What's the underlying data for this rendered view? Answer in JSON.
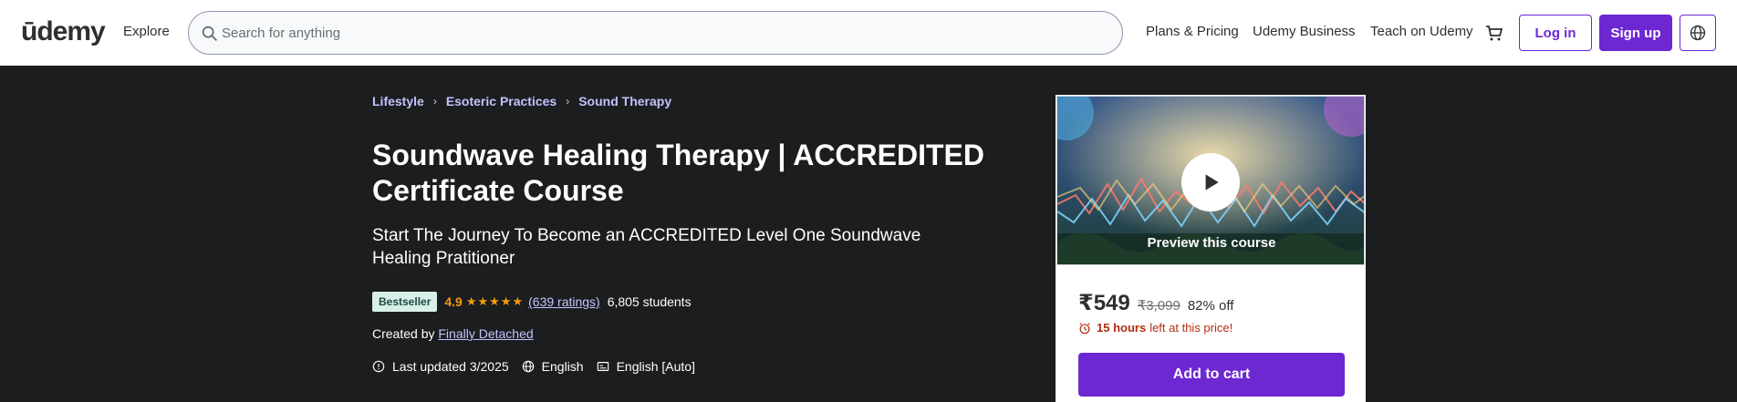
{
  "header": {
    "logo": "ūdemy",
    "explore": "Explore",
    "search_placeholder": "Search for anything",
    "nav": [
      "Plans & Pricing",
      "Udemy Business",
      "Teach on Udemy"
    ],
    "login": "Log in",
    "signup": "Sign up"
  },
  "breadcrumb": [
    "Lifestyle",
    "Esoteric Practices",
    "Sound Therapy"
  ],
  "course": {
    "title": "Soundwave Healing Therapy | ACCREDITED Certificate Course",
    "subtitle": "Start The Journey To Become an ACCREDITED Level One Soundwave Healing Pratitioner",
    "badge": "Bestseller",
    "rating": "4.9",
    "ratings_count": "(639 ratings)",
    "students": "6,805 students",
    "created_by_label": "Created by",
    "author": "Finally Detached",
    "last_updated": "Last updated 3/2025",
    "language": "English",
    "captions": "English [Auto]"
  },
  "card": {
    "preview_label": "Preview this course",
    "price": "₹549",
    "original_price": "₹3,099",
    "discount": "82% off",
    "timer_hours": "15 hours",
    "timer_text": "left at this price!",
    "add_to_cart": "Add to cart"
  },
  "colors": {
    "brand_purple": "#6d28d2",
    "hero_bg": "#1c1d1f",
    "star": "#f69c08",
    "link": "#c0c4fc",
    "alert": "#b32d0f"
  }
}
